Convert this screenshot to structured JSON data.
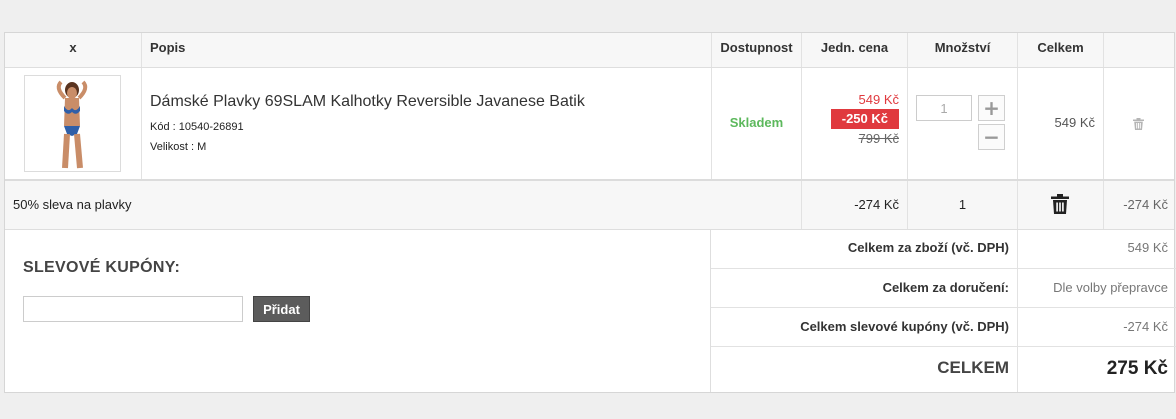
{
  "header": {
    "col_x": "x",
    "col_desc": "Popis",
    "col_avail": "Dostupnost",
    "col_unit": "Jedn. cena",
    "col_qty": "Množství",
    "col_total": "Celkem"
  },
  "product": {
    "name": "Dámské Plavky 69SLAM Kalhotky Reversible Javanese Batik",
    "code": "Kód : 10540-26891",
    "size": "Velikost : M",
    "availability": "Skladem",
    "price_current": "549 Kč",
    "price_discount": "-250 Kč",
    "price_old": "799 Kč",
    "quantity": "1",
    "qty_plus": "+",
    "qty_minus": "−",
    "total": "549 Kč"
  },
  "discount_row": {
    "label": "50% sleva na plavky",
    "unit_value": "-274 Kč",
    "quantity": "1",
    "total": "-274 Kč"
  },
  "coupons": {
    "title": "SLEVOVÉ KUPÓNY:",
    "input_value": "",
    "button_label": "Přidat"
  },
  "summary": {
    "goods_label": "Celkem za zboží (vč. DPH)",
    "goods_value": "549 Kč",
    "delivery_label": "Celkem za doručení:",
    "delivery_value": "Dle volby přepravce",
    "coupons_label": "Celkem slevové kupóny (vč. DPH)",
    "coupons_value": "-274 Kč",
    "total_label": "CELKEM",
    "total_value": "275 Kč"
  },
  "colors": {
    "accent_red": "#e0393e",
    "stock_green": "#5cb85c"
  },
  "icons": {
    "remove_item": "trash-icon",
    "remove_discount": "trash-icon"
  }
}
